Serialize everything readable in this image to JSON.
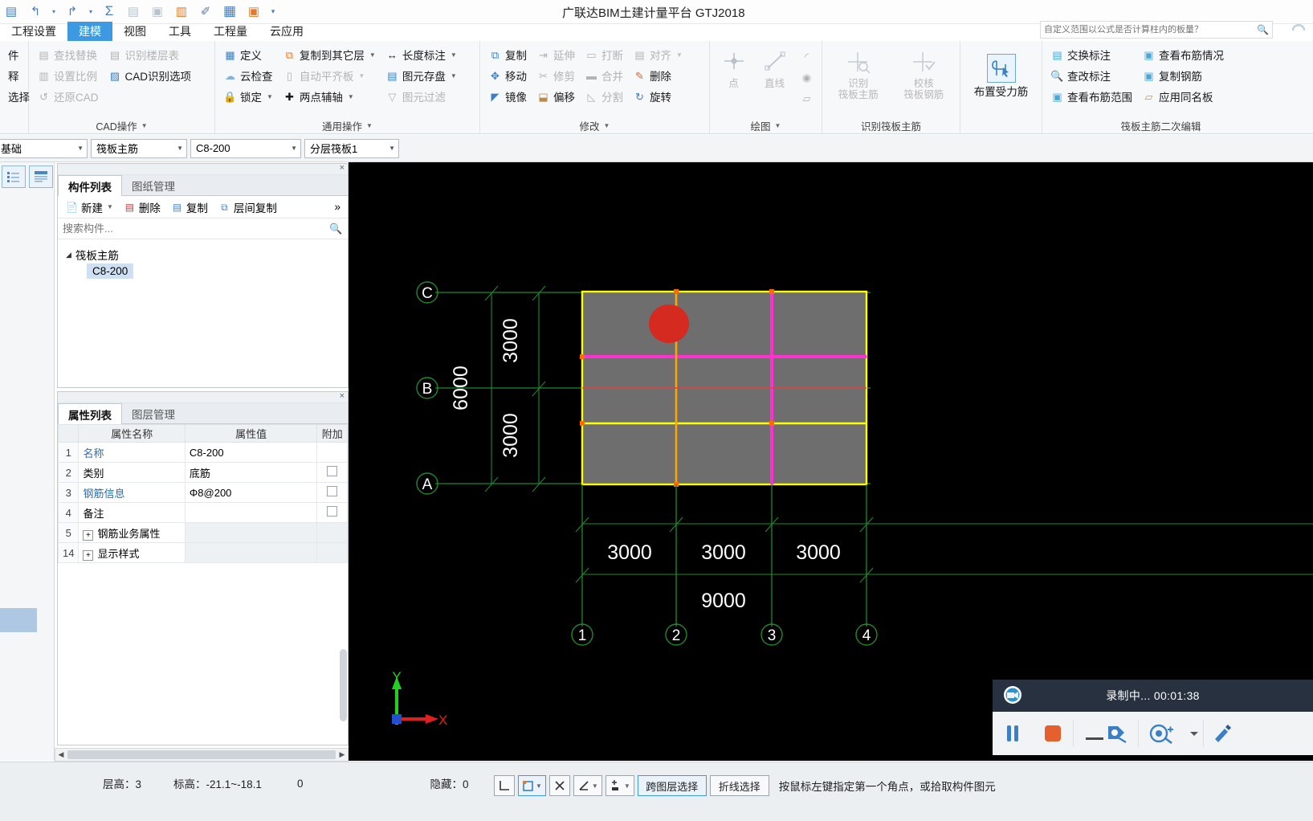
{
  "titlebar": {
    "app_title": "广联达BIM土建计量平台 GTJ2018",
    "search_placeholder": "自定义范围以公式是否计算柱内的板量？",
    "quick_access": [
      {
        "name": "save-icon",
        "glyph": "▤"
      },
      {
        "name": "undo-icon",
        "glyph": "↰"
      },
      {
        "name": "undo-dropdown-icon",
        "glyph": "▾"
      },
      {
        "name": "redo-icon",
        "glyph": "↱"
      },
      {
        "name": "redo-dropdown-icon",
        "glyph": "▾"
      },
      {
        "name": "sum-icon",
        "glyph": "Σ"
      },
      {
        "name": "report-icon",
        "glyph": "▤"
      },
      {
        "name": "preview-icon",
        "glyph": "▣"
      },
      {
        "name": "export-icon",
        "glyph": "▥"
      },
      {
        "name": "pen-icon",
        "glyph": "✐"
      },
      {
        "name": "grid-icon",
        "glyph": "▦"
      },
      {
        "name": "addfile-icon",
        "glyph": "▣"
      },
      {
        "name": "more-icon",
        "glyph": "▾"
      }
    ],
    "help_icon": "?"
  },
  "menu": {
    "tabs": [
      {
        "label": "工程设置",
        "active": false
      },
      {
        "label": "建模",
        "active": true
      },
      {
        "label": "视图",
        "active": false
      },
      {
        "label": "工具",
        "active": false
      },
      {
        "label": "工程量",
        "active": false
      },
      {
        "label": "云应用",
        "active": false
      }
    ]
  },
  "ribbon": {
    "groups": [
      {
        "title": "",
        "has_caret": false,
        "columns": [
          {
            "items": [
              {
                "label": "件",
                "icon": "",
                "disabled": false,
                "caret": false
              },
              {
                "label": "释",
                "icon": "",
                "disabled": false,
                "caret": false
              },
              {
                "label": "选择",
                "icon": "",
                "disabled": false,
                "caret": false
              }
            ]
          }
        ]
      },
      {
        "title": "CAD操作",
        "has_caret": true,
        "columns": [
          {
            "items": [
              {
                "label": "查找替换",
                "icon": "🔍",
                "disabled": true,
                "caret": false
              },
              {
                "label": "设置比例",
                "icon": "▥",
                "disabled": true,
                "caret": false
              },
              {
                "label": "还原CAD",
                "icon": "↺",
                "disabled": true,
                "caret": false
              }
            ]
          },
          {
            "items": [
              {
                "label": "识别楼层表",
                "icon": "▤",
                "disabled": true,
                "caret": false
              },
              {
                "label": "CAD识别选项",
                "icon": "▨",
                "disabled": false,
                "caret": false
              }
            ]
          }
        ]
      },
      {
        "title": "通用操作",
        "has_caret": true,
        "columns": [
          {
            "items": [
              {
                "label": "定义",
                "icon": "▦",
                "disabled": false,
                "caret": false
              },
              {
                "label": "云检查",
                "icon": "☁",
                "disabled": false,
                "caret": false
              },
              {
                "label": "锁定",
                "icon": "🔒",
                "disabled": false,
                "caret": true
              }
            ]
          },
          {
            "items": [
              {
                "label": "复制到其它层",
                "icon": "⧉",
                "disabled": false,
                "caret": true
              },
              {
                "label": "自动平齐板",
                "icon": "▯",
                "disabled": true,
                "caret": true
              },
              {
                "label": "两点辅轴",
                "icon": "✚",
                "disabled": false,
                "caret": true
              }
            ]
          },
          {
            "items": [
              {
                "label": "长度标注",
                "icon": "↔",
                "disabled": false,
                "caret": true
              },
              {
                "label": "图元存盘",
                "icon": "▤",
                "disabled": false,
                "caret": true
              },
              {
                "label": "图元过滤",
                "icon": "▽",
                "disabled": true,
                "caret": false
              }
            ]
          }
        ]
      },
      {
        "title": "修改",
        "has_caret": true,
        "columns": [
          {
            "items": [
              {
                "label": "复制",
                "icon": "⧉",
                "disabled": false,
                "caret": false
              },
              {
                "label": "移动",
                "icon": "✥",
                "disabled": false,
                "caret": false
              },
              {
                "label": "镜像",
                "icon": "◤",
                "disabled": false,
                "caret": false
              }
            ]
          },
          {
            "items": [
              {
                "label": "延伸",
                "icon": "⇥",
                "disabled": true,
                "caret": false
              },
              {
                "label": "修剪",
                "icon": "✂",
                "disabled": true,
                "caret": false
              },
              {
                "label": "偏移",
                "icon": "⬓",
                "disabled": false,
                "caret": false
              }
            ]
          },
          {
            "items": [
              {
                "label": "打断",
                "icon": "▭",
                "disabled": true,
                "caret": false
              },
              {
                "label": "合并",
                "icon": "▬",
                "disabled": true,
                "caret": false
              },
              {
                "label": "分割",
                "icon": "◺",
                "disabled": true,
                "caret": false
              }
            ]
          },
          {
            "items": [
              {
                "label": "对齐",
                "icon": "▤",
                "disabled": true,
                "caret": true
              },
              {
                "label": "删除",
                "icon": "✎",
                "disabled": false,
                "caret": false
              },
              {
                "label": "旋转",
                "icon": "↻",
                "disabled": false,
                "caret": false
              }
            ]
          }
        ]
      },
      {
        "title": "绘图",
        "has_caret": true,
        "big_items": [
          {
            "label": "点",
            "icon": "point-icon",
            "disabled": true
          },
          {
            "label": "直线",
            "icon": "line-icon",
            "disabled": true
          },
          {
            "label": "",
            "icon": "shapes-icon",
            "disabled": true
          }
        ]
      },
      {
        "title": "识别筏板主筋",
        "has_caret": false,
        "big_items": [
          {
            "label": "识别\n筏板主筋",
            "icon": "identify-icon",
            "disabled": true
          },
          {
            "label": "校核\n筏板钢筋",
            "icon": "check-icon",
            "disabled": true
          }
        ]
      },
      {
        "title": "",
        "has_caret": false,
        "big_items": [
          {
            "label": "布置受力筋",
            "icon": "layout-rebar-icon",
            "disabled": false
          }
        ]
      },
      {
        "title": "筏板主筋二次编辑",
        "has_caret": false,
        "columns": [
          {
            "items": [
              {
                "label": "交换标注",
                "icon": "▤",
                "disabled": false,
                "caret": false
              },
              {
                "label": "查改标注",
                "icon": "🔍",
                "disabled": false,
                "caret": false
              },
              {
                "label": "查看布筋范围",
                "icon": "▣",
                "disabled": false,
                "caret": false
              }
            ]
          },
          {
            "items": [
              {
                "label": "查看布筋情况",
                "icon": "▣",
                "disabled": false,
                "caret": false
              },
              {
                "label": "复制钢筋",
                "icon": "▣",
                "disabled": false,
                "caret": false
              },
              {
                "label": "应用同名板",
                "icon": "▱",
                "disabled": false,
                "caret": false
              }
            ]
          }
        ]
      }
    ]
  },
  "selectbar": {
    "floor": "基础",
    "category": "筏板主筋",
    "component": "C8-200",
    "layer": "分层筏板1"
  },
  "component_panel": {
    "tabs": [
      {
        "label": "构件列表",
        "active": true
      },
      {
        "label": "图纸管理",
        "active": false
      }
    ],
    "toolbar": [
      {
        "label": "新建",
        "icon": "📄",
        "caret": true
      },
      {
        "label": "删除",
        "icon": "✖",
        "caret": false
      },
      {
        "label": "复制",
        "icon": "▤",
        "caret": false
      },
      {
        "label": "层间复制",
        "icon": "⧉",
        "caret": false
      }
    ],
    "overflow": "»",
    "search_placeholder": "搜索构件...",
    "search_icon": "🔍",
    "tree": {
      "root": "筏板主筋",
      "children": [
        "C8-200"
      ],
      "selected": "C8-200"
    },
    "close_glyph": "×"
  },
  "property_panel": {
    "tabs": [
      {
        "label": "属性列表",
        "active": true
      },
      {
        "label": "图层管理",
        "active": false
      }
    ],
    "headers": [
      "",
      "属性名称",
      "属性值",
      "附加"
    ],
    "rows": [
      {
        "idx": "1",
        "name": "名称",
        "value": "C8-200",
        "link": true,
        "has_check": false,
        "expander": false
      },
      {
        "idx": "2",
        "name": "类别",
        "value": "底筋",
        "link": false,
        "has_check": true,
        "expander": false
      },
      {
        "idx": "3",
        "name": "钢筋信息",
        "value": "Φ8@200",
        "link": true,
        "has_check": true,
        "expander": false
      },
      {
        "idx": "4",
        "name": "备注",
        "value": "",
        "link": false,
        "has_check": true,
        "expander": false
      },
      {
        "idx": "5",
        "name": "钢筋业务属性",
        "value": "",
        "link": false,
        "has_check": false,
        "expander": true
      },
      {
        "idx": "14",
        "name": "显示样式",
        "value": "",
        "link": false,
        "has_check": false,
        "expander": true
      }
    ],
    "close_glyph": "×"
  },
  "canvas": {
    "background": "#000000",
    "grid_color": "#1f8a2f",
    "slab_fill": "#6e6e6e",
    "slab_border": "#ffff00",
    "rebar_magenta": "#ff2fd0",
    "rebar_orange": "#ffa500",
    "rebar_red": "#e03030",
    "cursor_color": "#d02020",
    "horizontal_axis_labels": [
      "C",
      "B",
      "A"
    ],
    "vertical_axis_labels": [
      "1",
      "2",
      "3",
      "4"
    ],
    "vertical_dims": [
      "3000",
      "3000"
    ],
    "vertical_total": "6000",
    "horizontal_dims": [
      "3000",
      "3000",
      "3000"
    ],
    "horizontal_total": "9000",
    "axis_widget": {
      "x": "X",
      "y": "Y"
    }
  },
  "statusbar": {
    "floor_height_label": "层高：3",
    "elevation_label": "标高：-21.1~-18.1",
    "zero_value": "0",
    "hidden_label": "隐藏：0",
    "tools": [
      {
        "name": "ortho-icon",
        "glyph": "⌐",
        "caret": false
      },
      {
        "name": "object-snap-icon",
        "glyph": "▢",
        "caret": true
      },
      {
        "name": "no-snap-icon",
        "glyph": "✕",
        "caret": false
      },
      {
        "name": "angle-snap-icon",
        "glyph": "∠",
        "caret": true
      },
      {
        "name": "point-snap-icon",
        "glyph": "✛",
        "caret": true
      }
    ],
    "cross_layer_select": "跨图层选择",
    "polyline_select": "折线选择",
    "hint": "按鼠标左键指定第一个角点，或拾取构件图元"
  },
  "recorder": {
    "camera_icon": "recorder-camera-icon",
    "status": "录制中... 00:01:38",
    "buttons": [
      {
        "name": "pause-button",
        "glyph": "❚❚"
      },
      {
        "name": "stop-button",
        "glyph": "■"
      },
      {
        "name": "draw-tool-button",
        "glyph": "✎"
      },
      {
        "name": "spotlight-button",
        "glyph": "◎"
      },
      {
        "name": "more-button",
        "glyph": "▾"
      },
      {
        "name": "settings-button",
        "glyph": "✎"
      }
    ]
  }
}
